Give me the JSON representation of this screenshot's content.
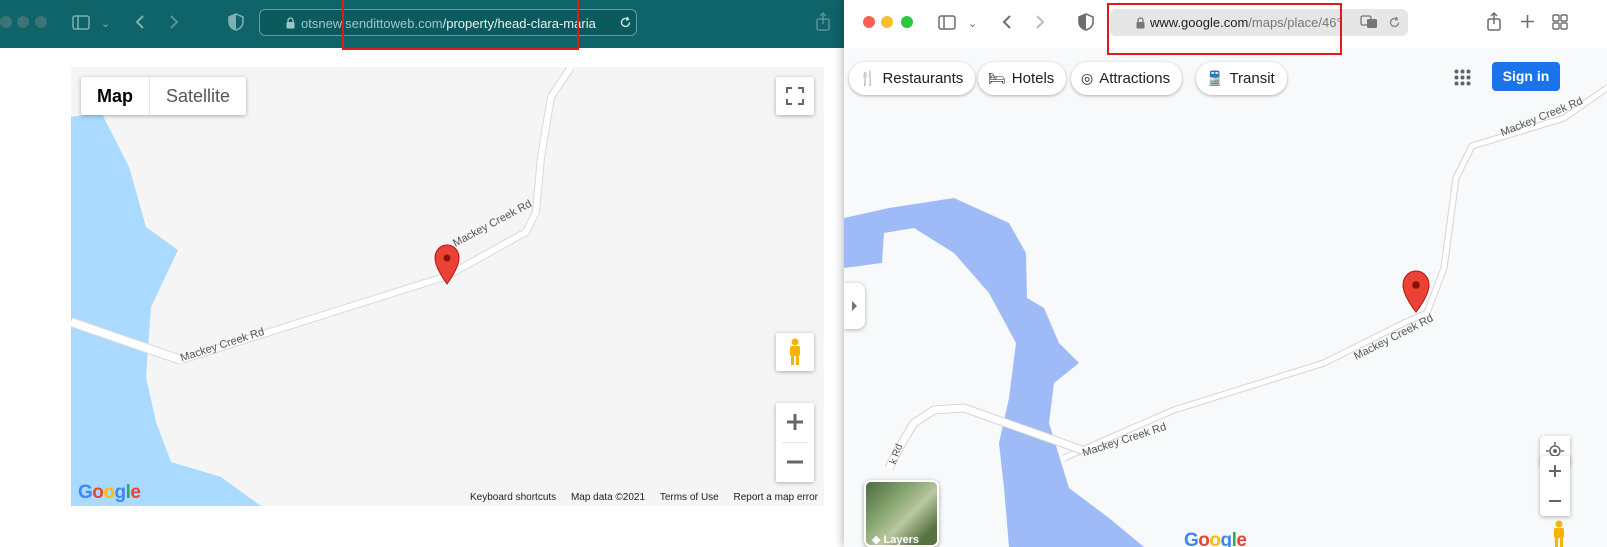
{
  "left_window": {
    "url": {
      "domain": "otsnew.sendittoweb.com",
      "path": "/property/head-clara-maria"
    },
    "map": {
      "map_type_options": [
        "Map",
        "Satellite"
      ],
      "selected_map_type": "Map",
      "road_labels": [
        "Mackey Creek Rd",
        "Mackey Creek Rd"
      ],
      "logo_text": "Google",
      "footer_links": [
        "Keyboard shortcuts",
        "Map data ©2021",
        "Terms of Use",
        "Report a map error"
      ]
    }
  },
  "right_window": {
    "url": {
      "domain": "www.google.com",
      "path": "/maps/place/46°"
    },
    "chips": [
      {
        "label": "Restaurants",
        "icon": "fork-knife-icon"
      },
      {
        "label": "Hotels",
        "icon": "bed-icon"
      },
      {
        "label": "Attractions",
        "icon": "camera-icon"
      },
      {
        "label": "Transit",
        "icon": "train-icon"
      }
    ],
    "sign_in_label": "Sign in",
    "road_labels": [
      "Mackey Creek Rd",
      "Mackey Creek Rd",
      "Mackey Creek Rd",
      "k Rd"
    ],
    "layers_label": "Layers",
    "logo_text": "Google"
  },
  "colors": {
    "left_toolbar": "#0e6468",
    "water_left": "#aadaff",
    "water_right": "#9ebbf7",
    "marker": "#ea4335",
    "sign_in": "#1a73e8",
    "highlight_box": "#e0191b"
  }
}
